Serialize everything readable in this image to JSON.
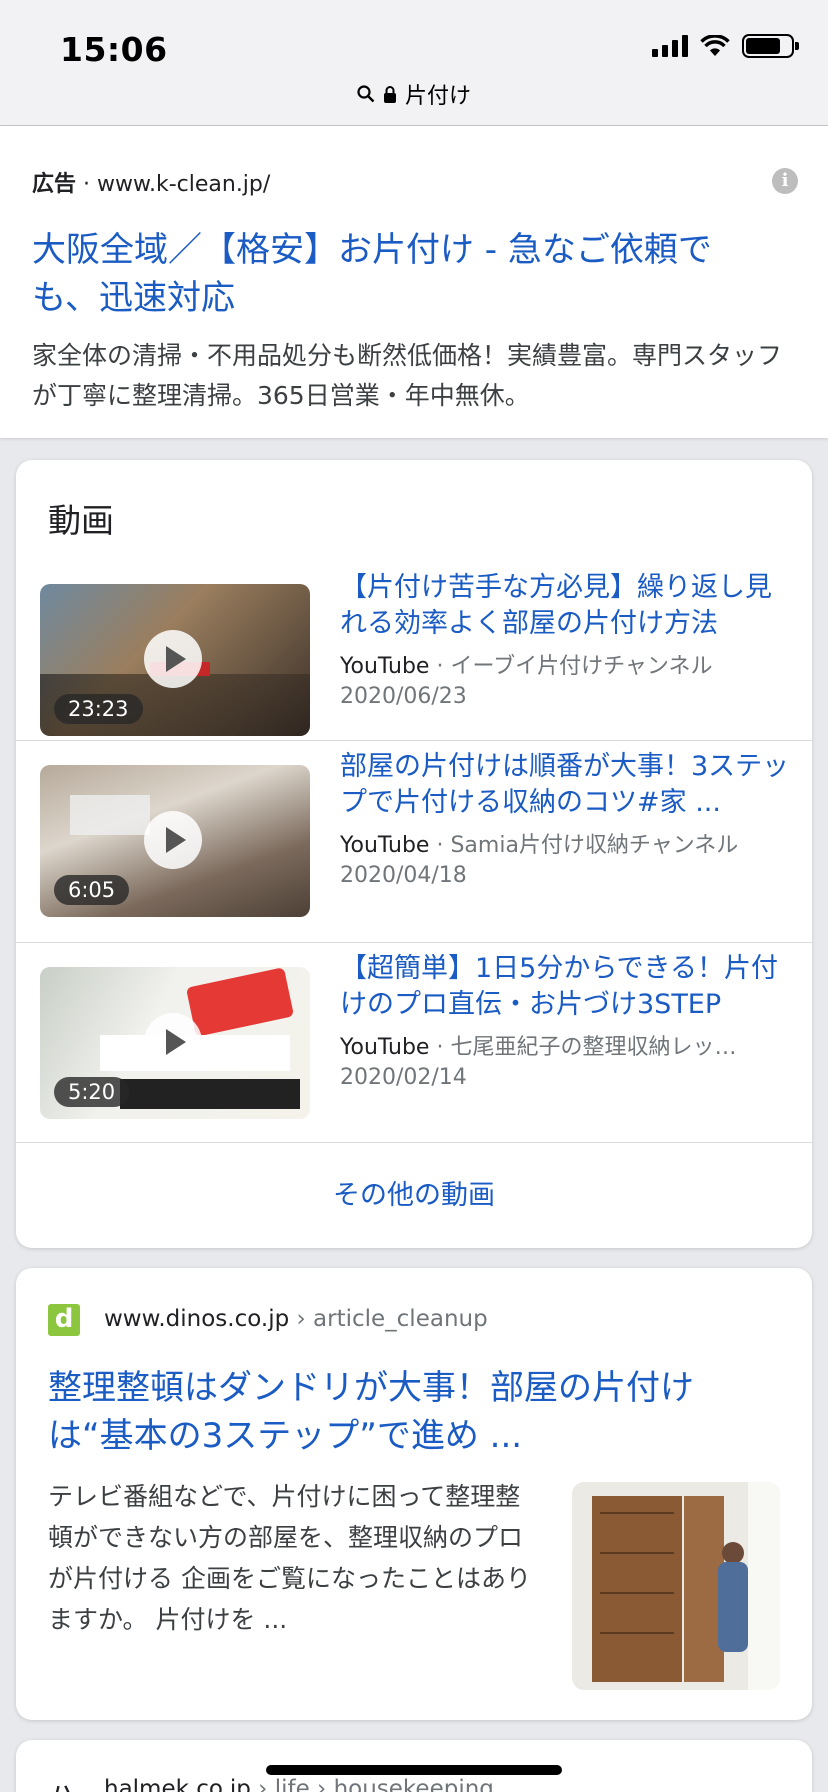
{
  "status": {
    "time": "15:06"
  },
  "urlbar": {
    "text": "片付け"
  },
  "ad": {
    "label": "広告",
    "url": "www.k-clean.jp/",
    "title": "大阪全域／【格安】お片付け - 急なご依頼でも、迅速対応",
    "description": "家全体の清掃・不用品処分も断然低価格！実績豊富。専門スタッフが丁寧に整理清掃。365日営業・年中無休。"
  },
  "videos": {
    "heading": "動画",
    "items": [
      {
        "title": "【片付け苦手な方必見】繰り返し見れる効率よく部屋の片付け方法",
        "source": "YouTube",
        "channel": "イーブイ片付けチャンネル",
        "date": "2020/06/23",
        "duration": "23:23"
      },
      {
        "title": "部屋の片付けは順番が大事！3ステップで片付ける収納のコツ#家 ...",
        "source": "YouTube",
        "channel": "Samia片付け収納チャンネル",
        "date": "2020/04/18",
        "duration": "6:05"
      },
      {
        "title": "【超簡単】1日5分からできる！片付けのプロ直伝・お片づけ3STEP",
        "source": "YouTube",
        "channel": "七尾亜紀子の整理収納レッ…",
        "date": "2020/02/14",
        "duration": "5:20"
      }
    ],
    "more_label": "その他の動画"
  },
  "result1": {
    "favicon_letter": "d",
    "domain": "www.dinos.co.jp",
    "path": "article_cleanup",
    "title": "整理整頓はダンドリが大事！部屋の片付けは“基本の3ステップ”で進め ...",
    "description": "テレビ番組などで、片付けに困って整理整頓ができない方の部屋を、整理収納のプロが片付ける 企画をご覧になったことはありますか。 片付けを ..."
  },
  "result2": {
    "domain": "halmek.co.jp",
    "path1": "life",
    "path2": "housekeeping"
  }
}
